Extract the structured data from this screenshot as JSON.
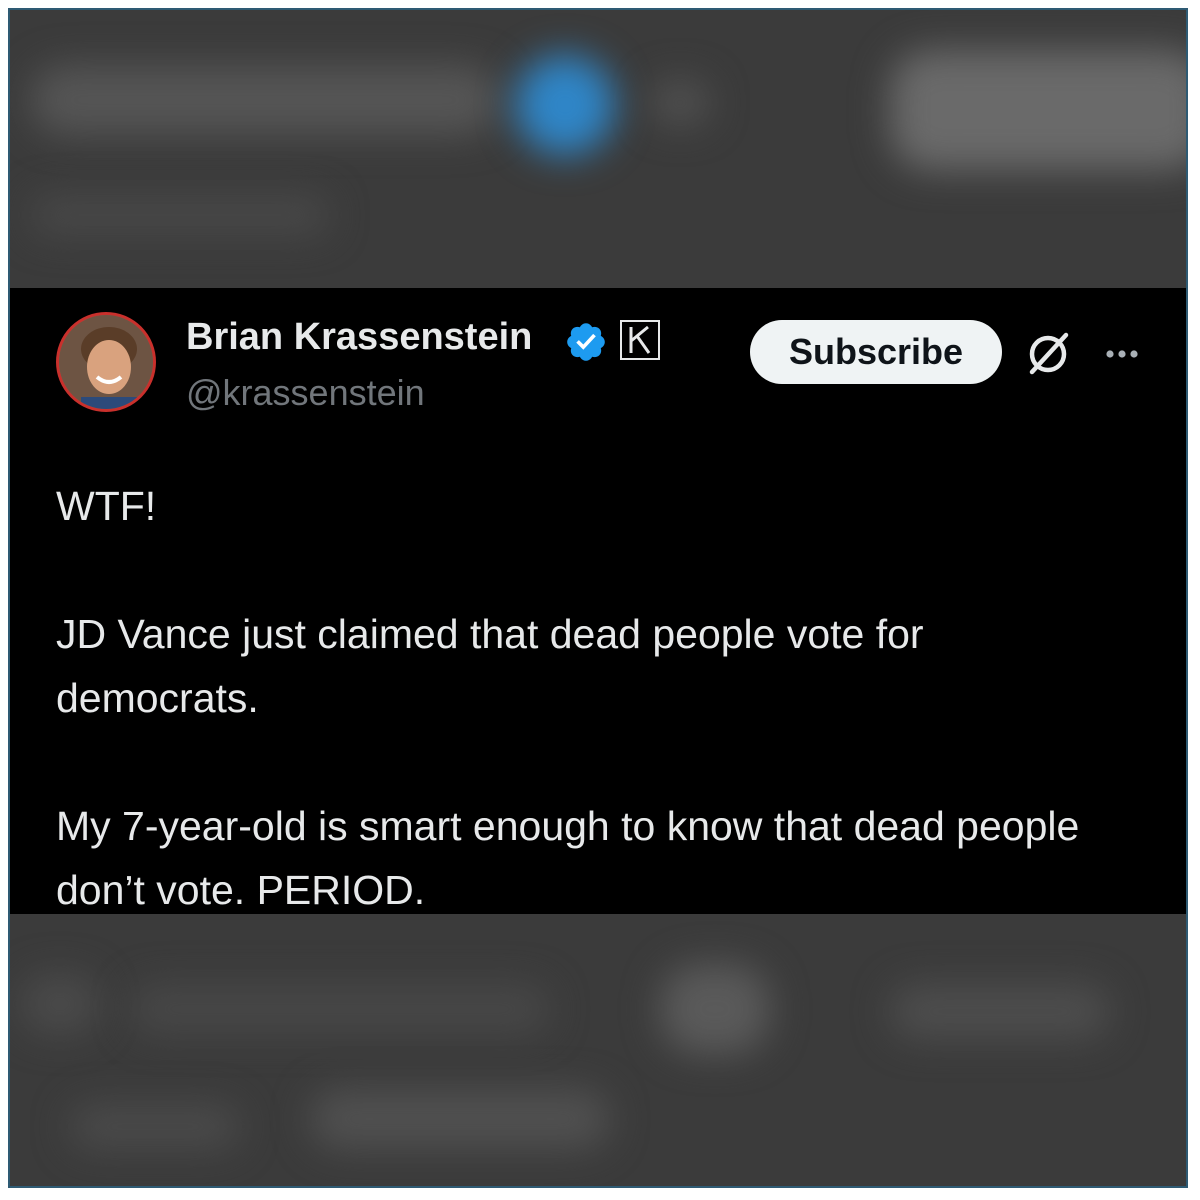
{
  "tweet": {
    "author": {
      "display_name": "Brian Krassenstein",
      "handle": "@krassenstein",
      "verified": true,
      "affiliate_badge_letter": "K"
    },
    "subscribe_label": "Subscribe",
    "body_lines": [
      "WTF!",
      "JD Vance just claimed that dead people vote for democrats.",
      "My 7-year-old is smart enough to know that dead people don’t vote. PERIOD."
    ]
  },
  "icons": {
    "verified": "verified-badge-icon",
    "grok": "grok-icon",
    "more": "more-options-icon"
  },
  "colors": {
    "background": "#000000",
    "text": "#e7e9ea",
    "muted": "#71767b",
    "verified_blue": "#1d9bf0",
    "avatar_ring": "#c9302c",
    "frame_border": "#2e5a73"
  }
}
